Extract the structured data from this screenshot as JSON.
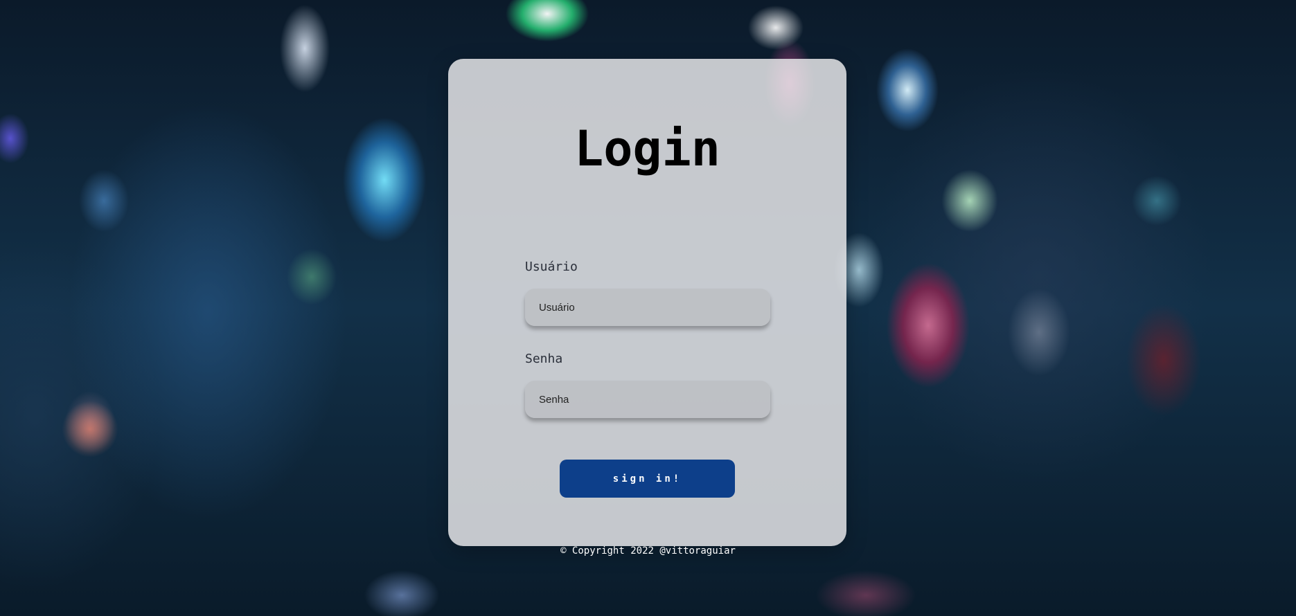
{
  "login": {
    "title": "Login",
    "username_label": "Usuário",
    "username_placeholder": "Usuário",
    "password_label": "Senha",
    "password_placeholder": "Senha",
    "submit_label": "sign in!"
  },
  "footer": {
    "copyright": "© Copyright 2022 @vittoraguiar"
  },
  "colors": {
    "button": "#0d3f8a",
    "card": "#e4e4e6"
  }
}
